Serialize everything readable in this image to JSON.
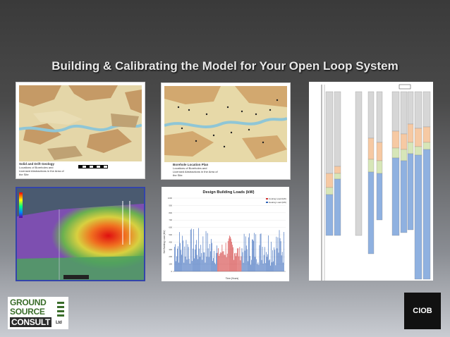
{
  "slide": {
    "title": "Building & Calibrating the Model for Your Open Loop System"
  },
  "maps": [
    {
      "caption_title": "Solid and Drift Geology",
      "caption_sub": "Locations of Boreholes and Licensed Abstractions in the Area of the Site"
    },
    {
      "caption_title": "Borehole Location Plan",
      "caption_sub": "Locations of Boreholes and Licensed Abstractions in the Area of the Site"
    }
  ],
  "chart": {
    "title": "Design Building Loads (kW)",
    "legend": [
      "Cooling Load (kW)",
      "Heating Load (kW)"
    ],
    "ylabel": "Net Building Load (kW)",
    "xlabel": "Time (Hours)",
    "yticks": [
      "1000",
      "900",
      "800",
      "700",
      "600",
      "500",
      "400",
      "300",
      "200",
      "100",
      "0"
    ]
  },
  "chart_data": {
    "type": "bar",
    "title": "Design Building Loads (kW)",
    "ylabel": "Net Building Load (kW)",
    "xlabel": "Time (Hours)",
    "ylim": [
      0,
      1000
    ],
    "series": [
      {
        "name": "Cooling Load (kW)",
        "color": "#d03030"
      },
      {
        "name": "Heating Load (kW)",
        "color": "#2f62b8"
      }
    ]
  },
  "logos": {
    "gsc_line1": "GROUND",
    "gsc_line2": "SOURCE",
    "gsc_line3": "CONSULT",
    "gsc_ltd": "Ltd",
    "ciob": "CIOB"
  },
  "colors": {
    "map_tan": "#d9c89a",
    "map_brown": "#b98a5a",
    "river": "#8fc6d6",
    "log_blue": "#8fb1e0",
    "log_orange": "#f6c9a3",
    "log_green": "#d7e6b8",
    "log_grey": "#d6d6d6"
  }
}
